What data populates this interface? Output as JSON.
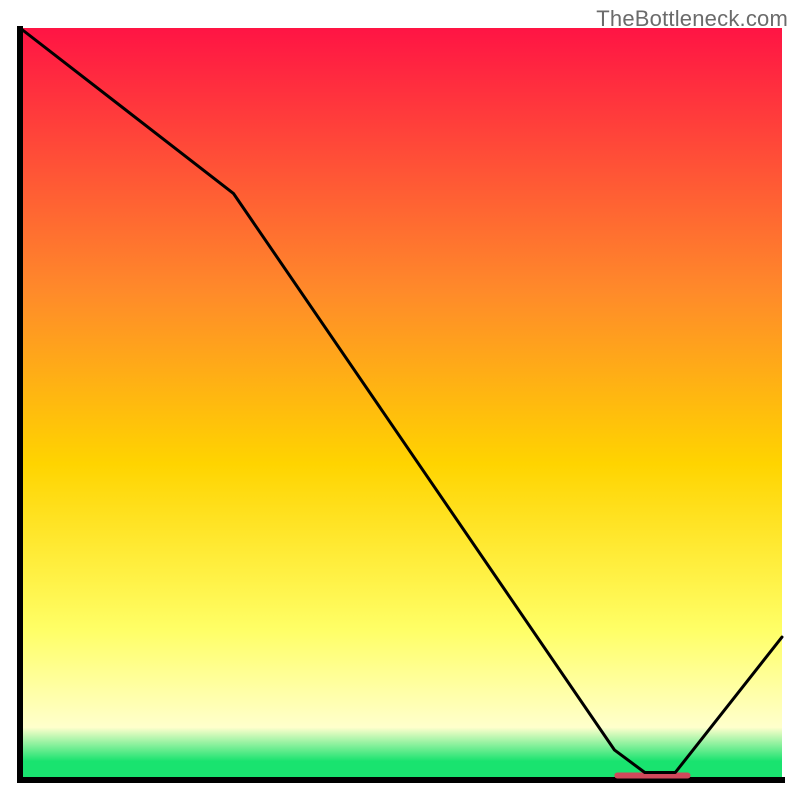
{
  "watermark": "TheBottleneck.com",
  "colors": {
    "grad_top": "#ff1444",
    "grad_upper_mid": "#ff8a2a",
    "grad_mid": "#ffd400",
    "grad_lower_mid": "#ffff66",
    "grad_pale": "#ffffcc",
    "grad_green": "#19e36f",
    "curve": "#000000",
    "axis": "#000000",
    "marker": "#d1495b"
  },
  "chart_data": {
    "type": "line",
    "title": "",
    "xlabel": "",
    "ylabel": "",
    "xlim": [
      0,
      100
    ],
    "ylim": [
      0,
      100
    ],
    "series": [
      {
        "name": "bottleneck-curve",
        "x": [
          0,
          28,
          78,
          82,
          86,
          100
        ],
        "values": [
          100,
          78,
          4,
          1,
          1,
          19
        ]
      }
    ],
    "markers": [
      {
        "name": "optimal-range",
        "x_start": 78,
        "x_end": 88,
        "y": 0.6
      }
    ],
    "gradient_stops": [
      {
        "offset": 0.0,
        "color": "grad_top"
      },
      {
        "offset": 0.35,
        "color": "grad_upper_mid"
      },
      {
        "offset": 0.58,
        "color": "grad_mid"
      },
      {
        "offset": 0.8,
        "color": "grad_lower_mid"
      },
      {
        "offset": 0.93,
        "color": "grad_pale"
      },
      {
        "offset": 0.975,
        "color": "grad_green"
      },
      {
        "offset": 1.0,
        "color": "grad_green"
      }
    ]
  }
}
